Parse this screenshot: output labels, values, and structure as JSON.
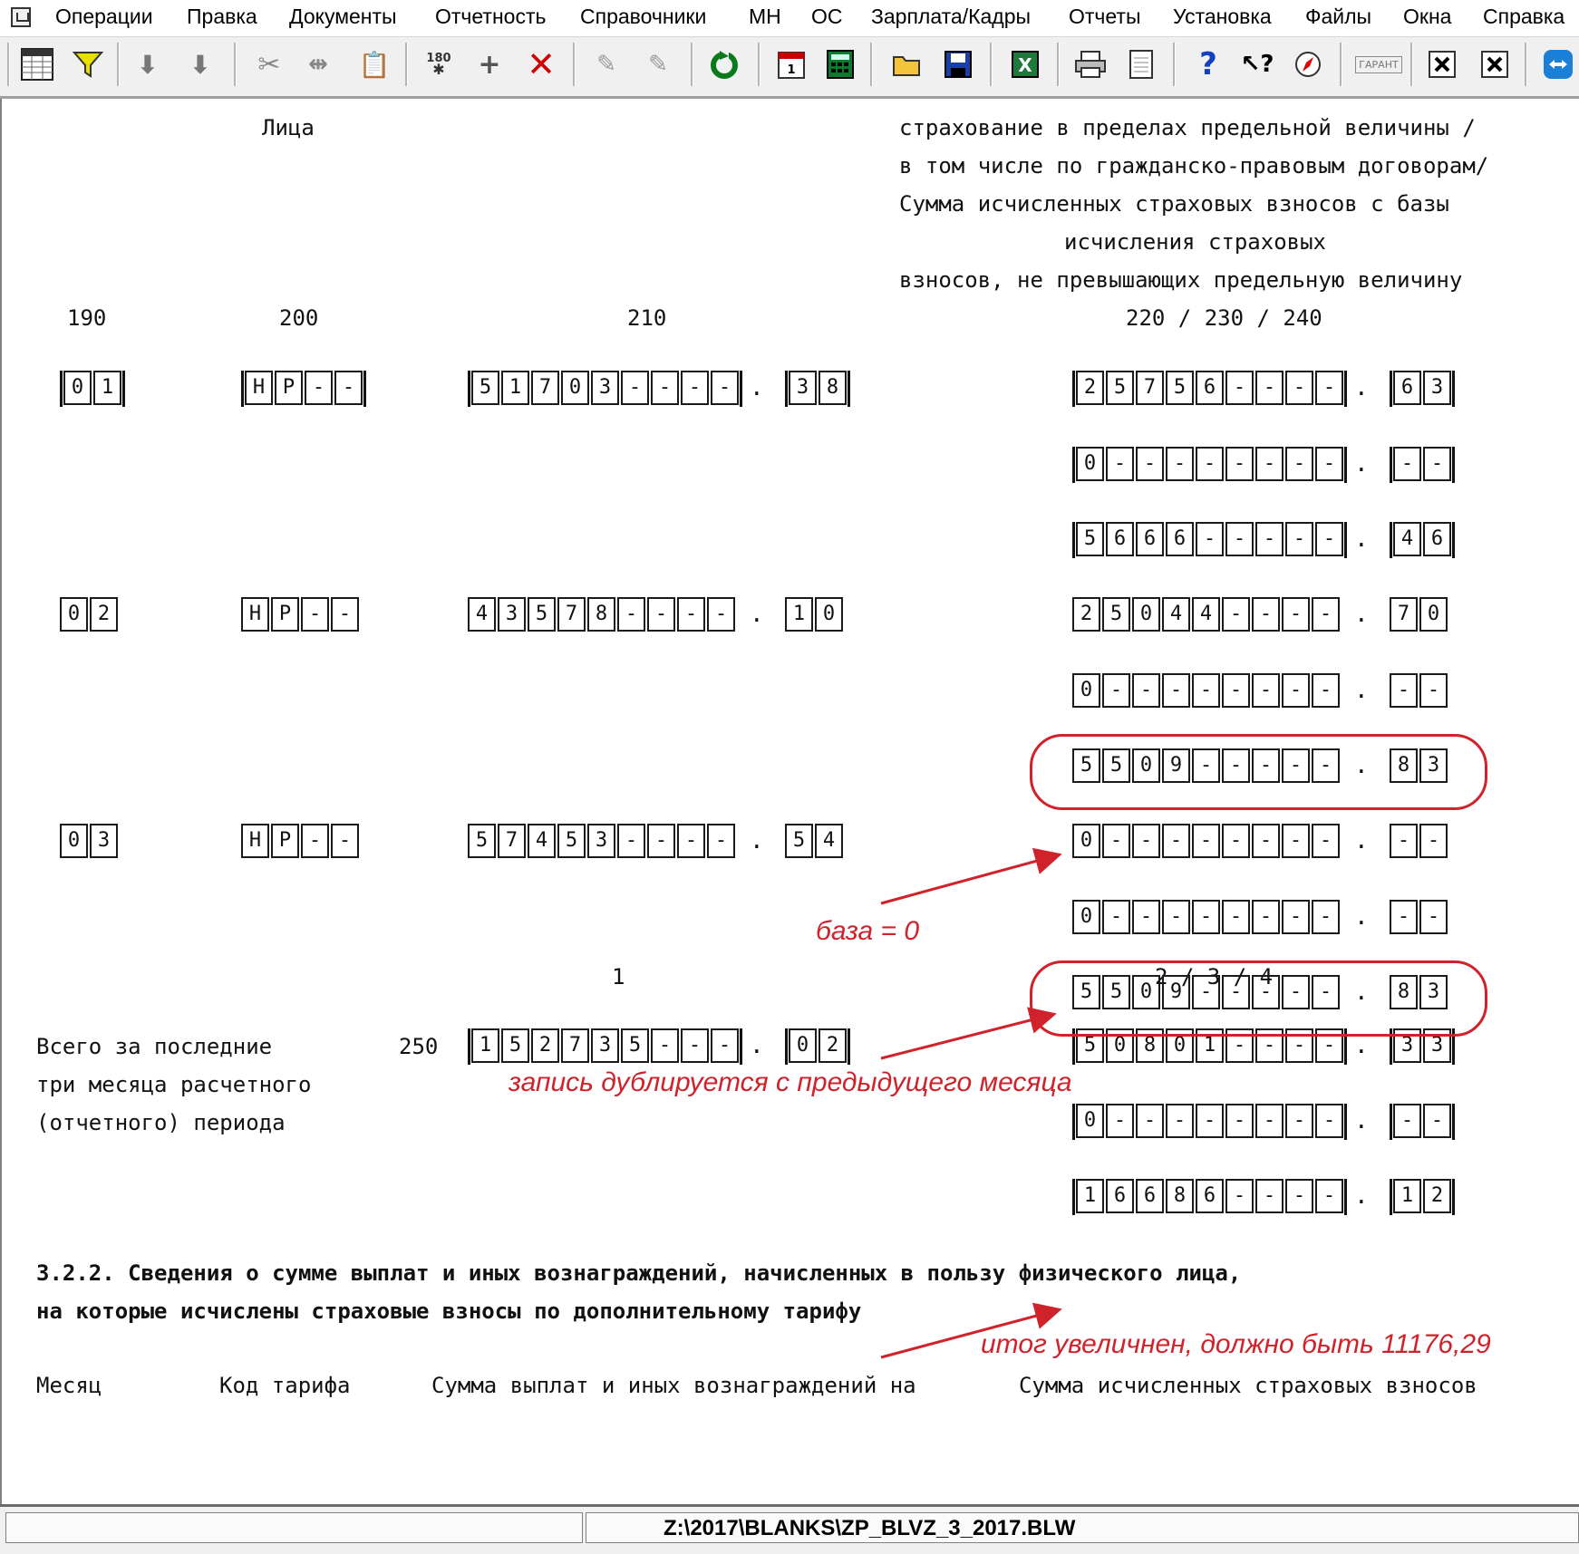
{
  "menu": {
    "items": [
      "Операции",
      "Правка",
      "Документы",
      "Отчетность",
      "Справочники",
      "МН",
      "ОС",
      "Зарплата/Кадры",
      "Отчеты",
      "Установка",
      "Файлы",
      "Окна",
      "Справка"
    ]
  },
  "toolbar": {
    "icons": [
      "table-icon",
      "filter-icon",
      "sort-asc-icon",
      "sort-desc-icon",
      "cut-icon",
      "split-icon",
      "paste-icon",
      "rotate-180-icon",
      "add-icon",
      "delete-icon",
      "marker-icon",
      "marker-ab-icon",
      "refresh-icon",
      "calendar-icon",
      "calculator-icon",
      "open-folder-icon",
      "save-icon",
      "excel-icon",
      "print-icon",
      "preview-icon",
      "help-icon",
      "context-help-icon",
      "compass-icon",
      "garant-icon",
      "close-window-icon",
      "close-all-icon",
      "teamviewer-icon"
    ],
    "labels": {
      "rotate": "180",
      "garant": "ГАРАНТ"
    }
  },
  "doc": {
    "header_lica": "Лица",
    "header_right": [
      "страхование в пределах предельной величины /",
      "в том числе по гражданско-правовым договорам/",
      "Сумма исчисленных страховых взносов с базы",
      "исчисления страховых",
      "взносов, не превышающих предельную величину"
    ],
    "col_190": "190",
    "col_200": "200",
    "col_210": "210",
    "col_220": "220 / 230 / 240",
    "rows": [
      {
        "c190": [
          "0",
          "1"
        ],
        "c200": [
          "Н",
          "Р",
          "-",
          "-"
        ],
        "c210": [
          "5",
          "1",
          "7",
          "0",
          "3",
          "-",
          "-",
          "-",
          "-"
        ],
        "c210_dec": [
          "3",
          "8"
        ]
      },
      {
        "c190": [
          "0",
          "2"
        ],
        "c200": [
          "Н",
          "Р",
          "-",
          "-"
        ],
        "c210": [
          "4",
          "3",
          "5",
          "7",
          "8",
          "-",
          "-",
          "-",
          "-"
        ],
        "c210_dec": [
          "1",
          "0"
        ]
      },
      {
        "c190": [
          "0",
          "3"
        ],
        "c200": [
          "Н",
          "Р",
          "-",
          "-"
        ],
        "c210": [
          "5",
          "7",
          "4",
          "5",
          "3",
          "-",
          "-",
          "-",
          "-"
        ],
        "c210_dec": [
          "5",
          "4"
        ]
      }
    ],
    "right_groups": [
      {
        "int": [
          "2",
          "5",
          "7",
          "5",
          "6",
          "-",
          "-",
          "-",
          "-"
        ],
        "dec": [
          "6",
          "3"
        ]
      },
      {
        "int": [
          "0",
          "-",
          "-",
          "-",
          "-",
          "-",
          "-",
          "-",
          "-"
        ],
        "dec": [
          "-",
          "-"
        ]
      },
      {
        "int": [
          "5",
          "6",
          "6",
          "6",
          "-",
          "-",
          "-",
          "-",
          "-"
        ],
        "dec": [
          "4",
          "6"
        ]
      },
      {
        "int": [
          "2",
          "5",
          "0",
          "4",
          "4",
          "-",
          "-",
          "-",
          "-"
        ],
        "dec": [
          "7",
          "0"
        ]
      },
      {
        "int": [
          "0",
          "-",
          "-",
          "-",
          "-",
          "-",
          "-",
          "-",
          "-"
        ],
        "dec": [
          "-",
          "-"
        ]
      },
      {
        "int": [
          "5",
          "5",
          "0",
          "9",
          "-",
          "-",
          "-",
          "-",
          "-"
        ],
        "dec": [
          "8",
          "3"
        ]
      },
      {
        "int": [
          "0",
          "-",
          "-",
          "-",
          "-",
          "-",
          "-",
          "-",
          "-"
        ],
        "dec": [
          "-",
          "-"
        ]
      },
      {
        "int": [
          "0",
          "-",
          "-",
          "-",
          "-",
          "-",
          "-",
          "-",
          "-"
        ],
        "dec": [
          "-",
          "-"
        ]
      },
      {
        "int": [
          "5",
          "5",
          "0",
          "9",
          "-",
          "-",
          "-",
          "-",
          "-"
        ],
        "dec": [
          "8",
          "3"
        ]
      }
    ],
    "sub_col_1": "1",
    "sub_col_234": "2 / 3 / 4",
    "total_label": [
      "Всего за последние",
      "три месяца расчетного",
      "(отчетного) периода"
    ],
    "total_code": "250",
    "total_210": {
      "int": [
        "1",
        "5",
        "2",
        "7",
        "3",
        "5",
        "-",
        "-",
        "-"
      ],
      "dec": [
        "0",
        "2"
      ]
    },
    "total_right": [
      {
        "int": [
          "5",
          "0",
          "8",
          "0",
          "1",
          "-",
          "-",
          "-",
          "-"
        ],
        "dec": [
          "3",
          "3"
        ]
      },
      {
        "int": [
          "0",
          "-",
          "-",
          "-",
          "-",
          "-",
          "-",
          "-",
          "-"
        ],
        "dec": [
          "-",
          "-"
        ]
      },
      {
        "int": [
          "1",
          "6",
          "6",
          "8",
          "6",
          "-",
          "-",
          "-",
          "-"
        ],
        "dec": [
          "1",
          "2"
        ]
      }
    ],
    "section_322": [
      "3.2.2. Сведения о сумме выплат и иных вознаграждений, начисленных в пользу физического лица,",
      "на которые исчислены страховые взносы по дополнительному тарифу"
    ],
    "bottom_headers": [
      "Месяц",
      "Код тарифа",
      "Сумма выплат и иных вознаграждений на",
      "Сумма исчисленных страховых взносов"
    ]
  },
  "annotations": {
    "base_zero": "база = 0",
    "duplicated": "запись дублируется с предыдущего месяца",
    "total_wrong": "итог увеличнен, должно быть 11176,29",
    "color": "#d0222b"
  },
  "statusbar": {
    "path": "Z:\\2017\\BLANKS\\ZP_BLVZ_3_2017.BLW"
  }
}
